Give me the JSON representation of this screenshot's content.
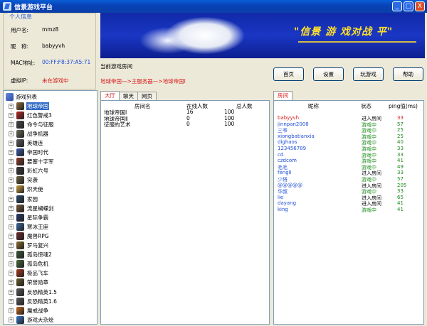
{
  "window": {
    "title": "信景游戏平台",
    "min_label": "_",
    "max_label": "□",
    "close_label": "X"
  },
  "colors": {
    "titlebar": "#0a4fc8",
    "selected": "#316ac5",
    "red": "#d81c1c",
    "green": "#1a8a1a"
  },
  "personal": {
    "legend": "个人信息",
    "username_label": "用户名:",
    "username": "mmz8",
    "nickname_label": "昵　称:",
    "nickname": "babyyvh",
    "mac_label": "MAC地址:",
    "mac": "00:FF:F8:37:A5:71",
    "ip_label": "虚拟IP:",
    "ip": "未在游戏中"
  },
  "banner": {
    "slogan": "\"信景 游 戏对战 平\""
  },
  "current": {
    "label": "当前游戏房间",
    "path": "地球帝国—>主服务器—>地球帝国Ⅰ"
  },
  "toolbar": {
    "home": "首页",
    "settings": "设置",
    "play": "玩游戏",
    "help": "帮助"
  },
  "tree": {
    "root": "游戏列表",
    "items": [
      {
        "label": "地球帝国",
        "icon": "empire-earth-icon",
        "color": "#8a6a3a"
      },
      {
        "label": "红色警戒3",
        "icon": "red-alert-icon",
        "color": "#b8261e"
      },
      {
        "label": "命令与征服",
        "icon": "command-conquer-icon",
        "color": "#4a4a4a"
      },
      {
        "label": "战争机器",
        "icon": "war-machine-icon",
        "color": "#6a6a5a"
      },
      {
        "label": "英雄连",
        "icon": "company-of-heroes-icon",
        "color": "#5a5a5a"
      },
      {
        "label": "帝国时代",
        "icon": "age-of-empires-icon",
        "color": "#3a5aa8"
      },
      {
        "label": "要塞十字军",
        "icon": "stronghold-icon",
        "color": "#8a3a2a"
      },
      {
        "label": "彩虹六号",
        "icon": "rainbow-six-icon",
        "color": "#3a3a3a"
      },
      {
        "label": "突袭",
        "icon": "sudden-strike-icon",
        "color": "#6a6040"
      },
      {
        "label": "炽天使",
        "icon": "seraph-icon",
        "color": "#c8a040"
      },
      {
        "label": "家园",
        "icon": "homeworld-icon",
        "color": "#2a4a6a"
      },
      {
        "label": "流星蝴蝶剑",
        "icon": "meteor-blade-icon",
        "color": "#7a5a3a"
      },
      {
        "label": "星际争霸",
        "icon": "starcraft-icon",
        "color": "#2a3a6a"
      },
      {
        "label": "寒冰王座",
        "icon": "frozen-throne-icon",
        "color": "#3a6aa0"
      },
      {
        "label": "魔兽RPG",
        "icon": "warcraft-rpg-icon",
        "color": "#6a2a2a"
      },
      {
        "label": "罗马复兴",
        "icon": "rome-icon",
        "color": "#8a6a2a"
      },
      {
        "label": "孤岛惊魂2",
        "icon": "far-cry-icon",
        "color": "#3a5a3a"
      },
      {
        "label": "孤岛危机",
        "icon": "crysis-icon",
        "color": "#4a6a3a"
      },
      {
        "label": "极品飞车",
        "icon": "need-for-speed-icon",
        "color": "#a83a1a"
      },
      {
        "label": "荣誉勋章",
        "icon": "medal-of-honor-icon",
        "color": "#6a5a2a"
      },
      {
        "label": "反恐精英1.5",
        "icon": "counter-strike-icon",
        "color": "#5a5a5a"
      },
      {
        "label": "反恐精英1.6",
        "icon": "counter-strike-icon",
        "color": "#5a5a5a"
      },
      {
        "label": "魔戒战争",
        "icon": "lotr-war-icon",
        "color": "#c86a1a"
      },
      {
        "label": "游戏大杂烩",
        "icon": "misc-games-icon",
        "color": "#3a7ac8"
      }
    ]
  },
  "room_tabs": [
    "大厅",
    "聊天",
    "网页"
  ],
  "rooms": {
    "headers": [
      "房间名",
      "在线人数",
      "总人数"
    ],
    "rows": [
      {
        "name": "地球帝国Ⅰ",
        "online": "16",
        "total": "100"
      },
      {
        "name": "地球帝国Ⅱ",
        "online": "0",
        "total": "100"
      },
      {
        "name": "征服的艺术",
        "online": "0",
        "total": "100"
      }
    ]
  },
  "player_tabs": [
    "房间"
  ],
  "players": {
    "headers": [
      "昵称",
      "状态",
      "ping值(ms)"
    ],
    "rows": [
      {
        "nick": "babyyvh",
        "status": "进入房间",
        "ping": "33",
        "me": true
      },
      {
        "nick": "jinnpan2008",
        "status": "游戏中",
        "ping": "57"
      },
      {
        "nick": "三爷",
        "status": "游戏中",
        "ping": "25"
      },
      {
        "nick": "xiongbatianxia",
        "status": "游戏中",
        "ping": "25"
      },
      {
        "nick": "dighaos",
        "status": "游戏中",
        "ping": "40"
      },
      {
        "nick": "123456789",
        "status": "游戏中",
        "ping": "33"
      },
      {
        "nick": "cd",
        "status": "游戏中",
        "ping": "33"
      },
      {
        "nick": "czdcom",
        "status": "游戏中",
        "ping": "41"
      },
      {
        "nick": "毛毛",
        "status": "游戏中",
        "ping": "49"
      },
      {
        "nick": "fengli",
        "status": "进入房间",
        "ping": "33"
      },
      {
        "nick": "少将",
        "status": "游戏中",
        "ping": "57"
      },
      {
        "nick": "@@@@@",
        "status": "进入房间",
        "ping": "205"
      },
      {
        "nick": "华叔",
        "status": "游戏中",
        "ping": "33"
      },
      {
        "nick": "lie",
        "status": "进入房间",
        "ping": "65"
      },
      {
        "nick": "dayang",
        "status": "进入房间",
        "ping": "41"
      },
      {
        "nick": "king",
        "status": "游戏中",
        "ping": "41"
      }
    ]
  }
}
